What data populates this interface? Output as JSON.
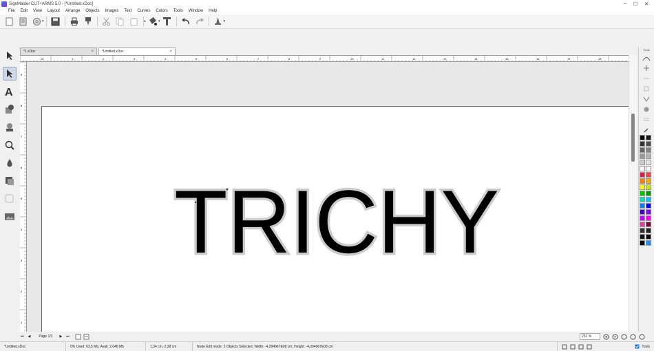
{
  "window": {
    "title": "SignMaster CUT+ARMS 5.0 - [*Untitled.xDoc]",
    "controls": [
      "–",
      "☐",
      "✕"
    ]
  },
  "menu": [
    "File",
    "Edit",
    "View",
    "Layout",
    "Arrange",
    "Objects",
    "Images",
    "Text",
    "Curves",
    "Colors",
    "Tools",
    "Window",
    "Help"
  ],
  "tabs": [
    {
      "label": "*1.xDoc",
      "close": "×"
    },
    {
      "label": "*Untitled.xDoc",
      "close": "×"
    }
  ],
  "canvas": {
    "text": "TRICHY"
  },
  "hruler_labels": [
    "10",
    "1",
    "2",
    "3",
    "4",
    "5",
    "6",
    "7",
    "8",
    "9",
    "10",
    "11",
    "12",
    "13",
    "14",
    "15",
    "16",
    "17",
    "18"
  ],
  "vruler_labels": [
    "9",
    "8",
    "7",
    "6",
    "5",
    "4",
    "3",
    "2",
    "1"
  ],
  "right_panel": {
    "label": "Tools"
  },
  "palette": [
    "#000000",
    "#1a1a1a",
    "#333333",
    "#4d4d4d",
    "#666666",
    "#808080",
    "#999999",
    "#b3b3b3",
    "#cccccc",
    "#e6e6e6",
    "#ffffff",
    "#ffffff",
    "#e6194b",
    "#ff3b3b",
    "#ff7f00",
    "#ffa500",
    "#ffff00",
    "#c8e600",
    "#00c800",
    "#00a000",
    "#00e0c0",
    "#00c8ff",
    "#0080ff",
    "#0000ff",
    "#4000c0",
    "#8000ff",
    "#c000ff",
    "#ff00ff",
    "#e040a0",
    "#800040",
    "#303030",
    "#202020",
    "#101010",
    "#000000",
    "#000000",
    "#1e90ff"
  ],
  "bottom_nav": {
    "first": "⏮",
    "prev": "◀",
    "page": "Page 1/1",
    "next": "▶",
    "last": "⏭"
  },
  "zoom": "231 %",
  "status": {
    "file": "*Untitled.xDoc",
    "memory": "0%  Used: 63,5 Mb, Avail: 2,048 Mb",
    "coords": "1,34 cm, 2,38 cm",
    "message": "Node Edit mode: 2 Objects Selected. Width: -4,294967E08 cm, Height: -4,294967E08 cm",
    "tools_label": "Tools"
  }
}
